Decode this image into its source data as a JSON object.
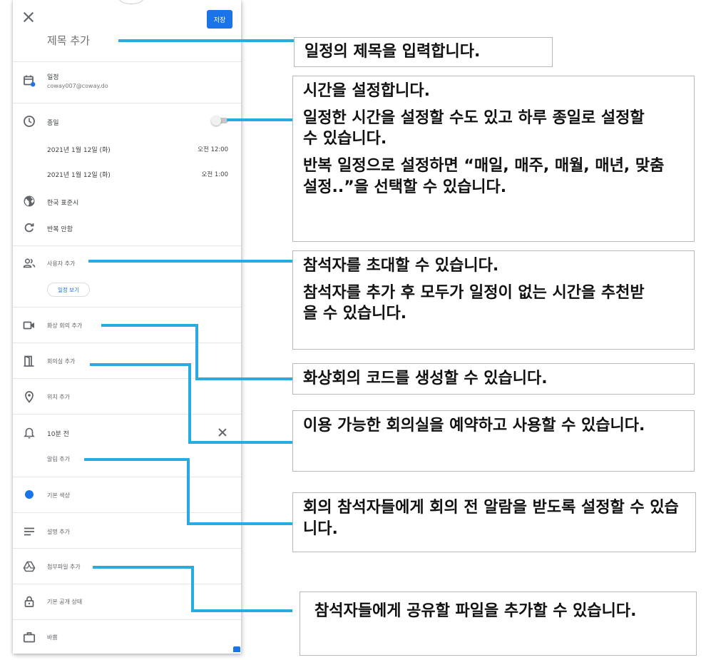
{
  "phone": {
    "save_label": "저장",
    "title_placeholder": "제목 추가",
    "calendar": {
      "name": "일정",
      "account": "coway007@coway.do"
    },
    "allday_label": "종일",
    "start": {
      "date": "2021년 1월 12일 (화)",
      "time": "오전 12:00"
    },
    "end": {
      "date": "2021년 1월 12일 (화)",
      "time": "오전 1:00"
    },
    "timezone": "한국 표준시",
    "repeat": "반복 안함",
    "add_people": "사용자 추가",
    "view_schedule": "일정 보기",
    "add_video": "화상 회의 추가",
    "add_room": "회의실 추가",
    "add_location": "위치 추가",
    "notification": "10분 전",
    "add_notification": "알림 추가",
    "color": "기본 색상",
    "add_description": "설명 추가",
    "add_attachment": "첨부파일 추가",
    "visibility": "기본 공개 상태",
    "availability": "바쁨"
  },
  "callouts": {
    "title": [
      "일정의 제목을 입력합니다."
    ],
    "time": [
      "시간을 설정합니다.",
      "일정한 시간을 설정할 수도 있고 하루 종일로 설정할 수 있습니다.",
      "반복 일정으로 설정하면 “매일, 매주, 매월, 매년, 맞춤 설정..”을 선택할 수 있습니다."
    ],
    "people": [
      "참석자를 초대할 수 있습니다.",
      "참석자를 추가 후 모두가 일정이 없는 시간을 추천받을 수 있습니다."
    ],
    "video": [
      "화상회의 코드를 생성할 수 있습니다."
    ],
    "room": [
      "이용 가능한 회의실을 예약하고 사용할 수 있습니다."
    ],
    "alarm": [
      "회의 참석자들에게 회의 전 알람을 받도록 설정할 수 있습니다."
    ],
    "file": [
      "참석자들에게 공유할 파일을 추가할 수 있습니다."
    ]
  },
  "colors": {
    "accent": "#1a73e8",
    "connector": "#29abe2"
  }
}
